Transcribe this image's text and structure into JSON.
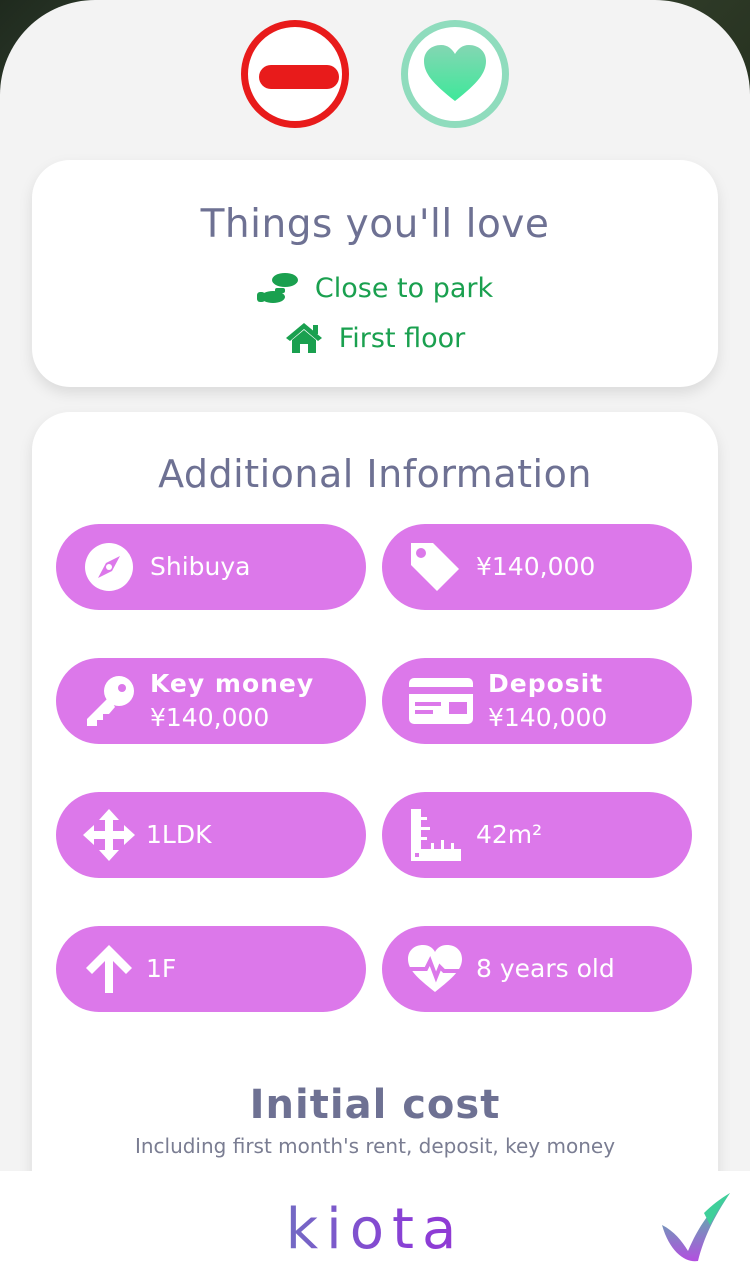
{
  "actions": {
    "reject_icon": "minus-circle-icon",
    "like_icon": "heart-icon"
  },
  "love": {
    "title": "Things you'll love",
    "items": [
      {
        "icon": "footprints-icon",
        "label": "Close to park"
      },
      {
        "icon": "home-icon",
        "label": "First floor"
      }
    ]
  },
  "info": {
    "title": "Additional Information",
    "pills": [
      {
        "icon": "compass-icon",
        "label": "Shibuya"
      },
      {
        "icon": "tag-icon",
        "label": "¥140,000"
      },
      {
        "icon": "key-icon",
        "heading": "Key money",
        "label": "¥140,000"
      },
      {
        "icon": "credit-card-icon",
        "heading": "Deposit",
        "label": "¥140,000"
      },
      {
        "icon": "arrows-move-icon",
        "label": "1LDK"
      },
      {
        "icon": "ruler-icon",
        "label": "42m²"
      },
      {
        "icon": "arrow-up-icon",
        "label": "1F"
      },
      {
        "icon": "heartbeat-icon",
        "label": "8 years old"
      }
    ]
  },
  "cost": {
    "title": "Initial cost",
    "subtitle": "Including first month's rent, deposit, key money"
  },
  "footer": {
    "brand": "kiota",
    "logo_icon": "checkmark-leaf-icon"
  },
  "colors": {
    "reject": "#e81b1b",
    "like": "#5fe3a0",
    "pill": "#dc78ea",
    "love_text": "#1aa04f",
    "title_text": "#6e7193"
  }
}
